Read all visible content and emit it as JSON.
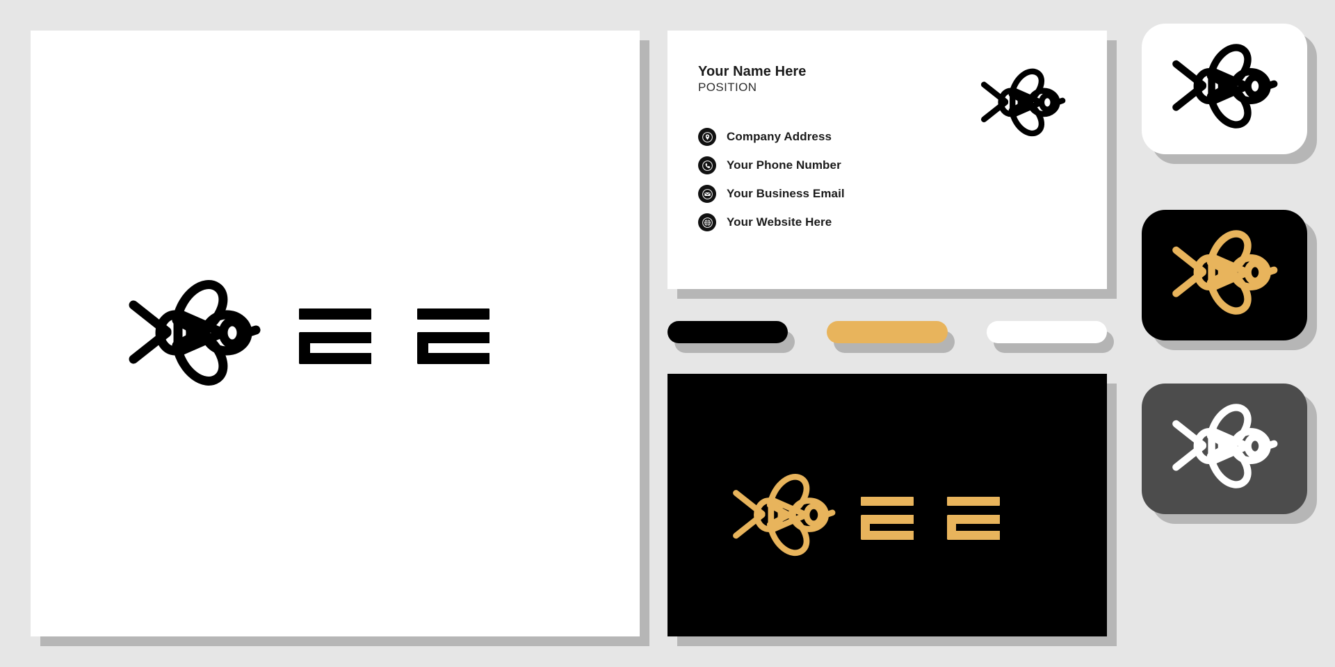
{
  "page": {
    "background_color": "#e6e6e6",
    "title": "Bee Logo Brand Identity Mockup"
  },
  "brand": {
    "name": "bee-logo",
    "colors": {
      "black": "#000000",
      "gold": "#e8b45c",
      "white": "#ffffff",
      "dark_gray": "#4c4c4c",
      "shadow_gray": "#b6b6b6",
      "page_gray": "#e6e6e6"
    }
  },
  "letterhead": {
    "name": "letterhead-poster",
    "background": "#ffffff",
    "logo_icon": "bee-icon",
    "logo_color": "#000000",
    "wordmark_color": "#000000",
    "wordmark_glyphs": [
      "glyph-e",
      "glyph-e"
    ]
  },
  "business_card": {
    "name": "business-card",
    "background": "#ffffff",
    "name_line": "Your Name Here",
    "position_line": "POSITION",
    "logo_icon": "bee-icon",
    "logo_color": "#000000",
    "contacts": [
      {
        "icon": "location-pin-icon",
        "label": "Company Address"
      },
      {
        "icon": "phone-icon",
        "label": "Your Phone Number"
      },
      {
        "icon": "envelope-icon",
        "label": "Your Business Email"
      },
      {
        "icon": "globe-icon",
        "label": "Your Website Here"
      }
    ]
  },
  "palette": {
    "name": "color-palette",
    "swatches": [
      {
        "name": "swatch-black",
        "color": "#000000"
      },
      {
        "name": "swatch-gold",
        "color": "#e8b45c"
      },
      {
        "name": "swatch-white",
        "color": "#ffffff"
      }
    ],
    "shadow_color": "#b4b4b4"
  },
  "dark_panel": {
    "name": "dark-panel",
    "background": "#000000",
    "logo_icon": "bee-icon",
    "logo_color": "#e8b45c",
    "wordmark_color": "#e8b45c",
    "wordmark_glyphs": [
      "glyph-e",
      "glyph-e"
    ]
  },
  "badges": [
    {
      "name": "badge-light",
      "background": "#ffffff",
      "logo_icon": "bee-icon",
      "logo_color": "#000000"
    },
    {
      "name": "badge-dark",
      "background": "#000000",
      "logo_icon": "bee-icon",
      "logo_color": "#e8b45c"
    },
    {
      "name": "badge-gray",
      "background": "#4c4c4c",
      "logo_icon": "bee-icon",
      "logo_color": "#ffffff"
    }
  ]
}
